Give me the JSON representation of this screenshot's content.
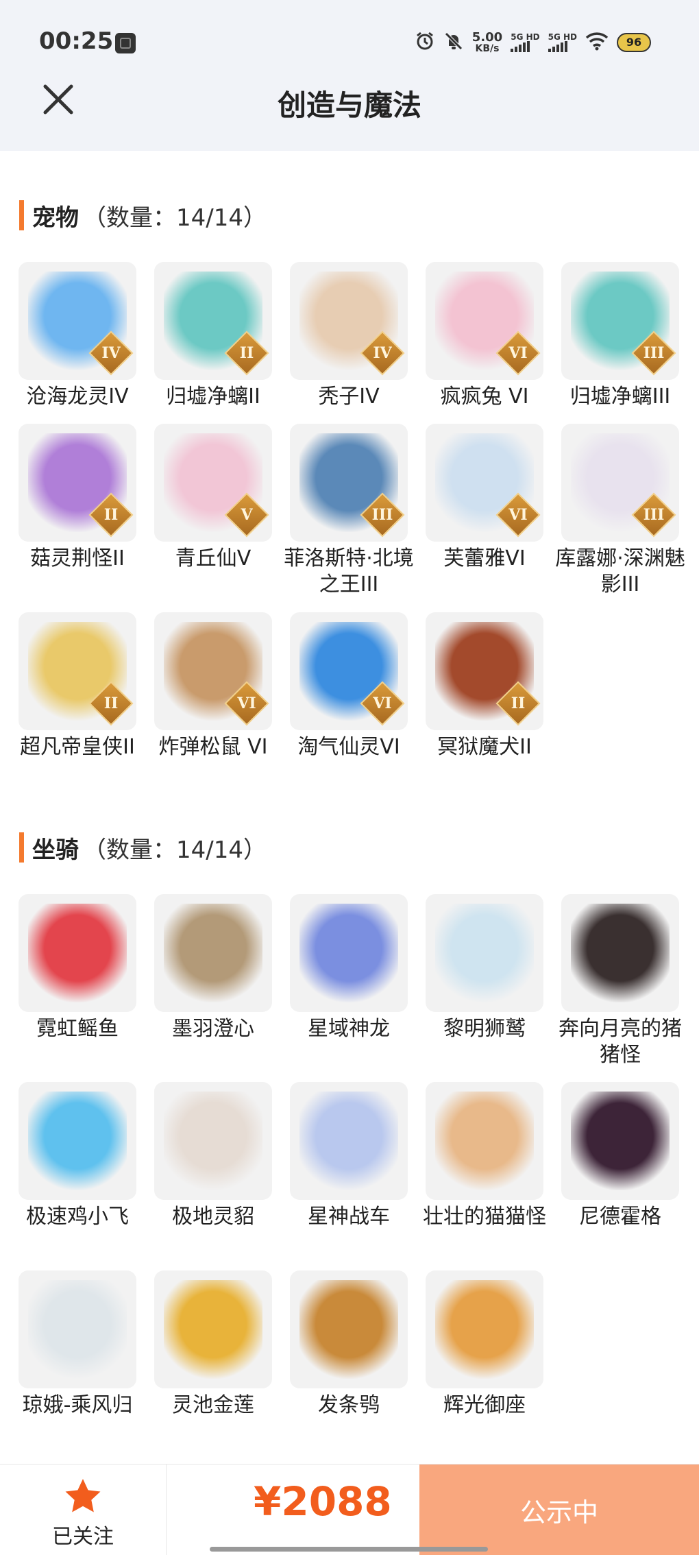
{
  "status_bar": {
    "time": "00:25",
    "net_speed_value": "5.00",
    "net_speed_unit": "KB/s",
    "sim1_label": "5G HD",
    "sim2_label": "5G HD",
    "battery": "96"
  },
  "header": {
    "title": "创造与魔法"
  },
  "pets": {
    "name": "宠物",
    "count": "（数量：14/14）",
    "items": [
      {
        "name": "沧海龙灵IV",
        "rank": "IV",
        "color": "#6fb6f0"
      },
      {
        "name": "归墟净螭II",
        "rank": "II",
        "color": "#6cc9c4"
      },
      {
        "name": "秃子IV",
        "rank": "IV",
        "color": "#e7cdb3"
      },
      {
        "name": "疯疯兔 VI",
        "rank": "VI",
        "color": "#f3c3d2"
      },
      {
        "name": "归墟净螭III",
        "rank": "III",
        "color": "#6cc9c4"
      },
      {
        "name": "菇灵荆怪II",
        "rank": "II",
        "color": "#b07fd8"
      },
      {
        "name": "青丘仙V",
        "rank": "V",
        "color": "#f2c6d6"
      },
      {
        "name": "菲洛斯特·北境之王III",
        "rank": "III",
        "color": "#5b89b8"
      },
      {
        "name": "芙蕾雅VI",
        "rank": "VI",
        "color": "#cfe0f0"
      },
      {
        "name": "库露娜·深渊魅影III",
        "rank": "III",
        "color": "#e8e2ee"
      },
      {
        "name": "超凡帝皇侠II",
        "rank": "II",
        "color": "#e9c96a"
      },
      {
        "name": "炸弹松鼠 VI",
        "rank": "VI",
        "color": "#c99b6c"
      },
      {
        "name": "淘气仙灵VI",
        "rank": "VI",
        "color": "#3d8fe0"
      },
      {
        "name": "冥狱魔犬II",
        "rank": "II",
        "color": "#a34a2c"
      }
    ]
  },
  "mounts": {
    "name": "坐骑",
    "count": "（数量：14/14）",
    "items": [
      {
        "name": "霓虹鳐鱼",
        "color": "#e3454d"
      },
      {
        "name": "墨羽澄心",
        "color": "#b39a78"
      },
      {
        "name": "星域神龙",
        "color": "#7b8fe0"
      },
      {
        "name": "黎明狮鹫",
        "color": "#cfe4f0"
      },
      {
        "name": "奔向月亮的猪猪怪",
        "color": "#3a3030"
      },
      {
        "name": "极速鸡小飞",
        "color": "#5fc1ee"
      },
      {
        "name": "极地灵貂",
        "color": "#e6dcd4"
      },
      {
        "name": "星神战车",
        "color": "#b9c8ee"
      },
      {
        "name": "壮壮的猫猫怪",
        "color": "#e8b98a"
      },
      {
        "name": "尼德霍格",
        "color": "#3d2438"
      },
      {
        "name": "琼娥-乘风归",
        "color": "#dfe6ea"
      },
      {
        "name": "灵池金莲",
        "color": "#e8b33a"
      },
      {
        "name": "发条鸮",
        "color": "#c98a3a"
      },
      {
        "name": "辉光御座",
        "color": "#e6a24a"
      }
    ]
  },
  "bottom": {
    "follow_label": "已关注",
    "price": "¥2088",
    "status_label": "公示中"
  }
}
